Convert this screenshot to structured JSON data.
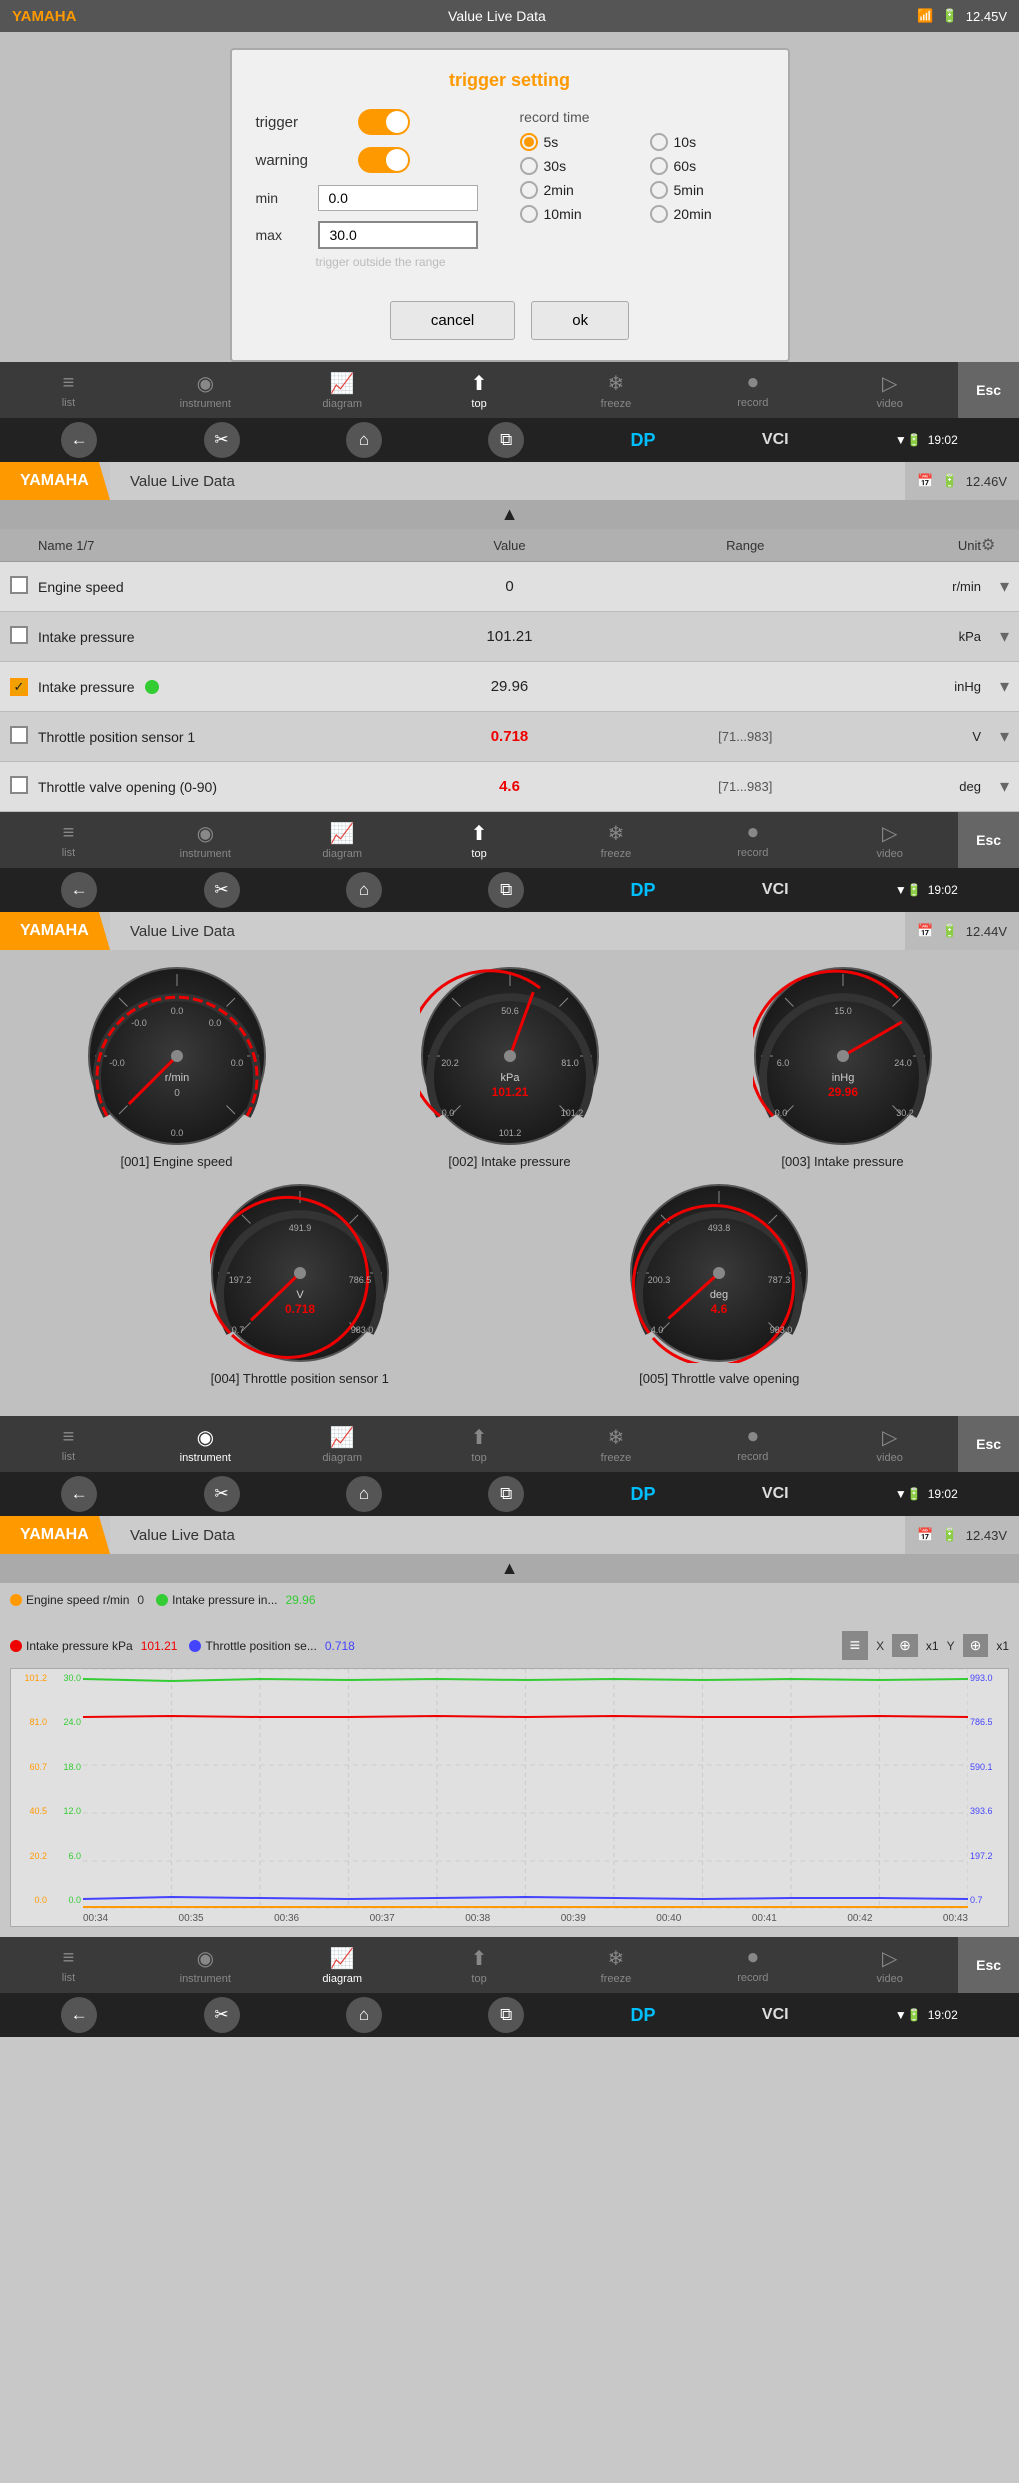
{
  "statusBar": {
    "brand": "YAMAHA",
    "title": "Value Live Data",
    "battery": "12.45V",
    "wifi": "▼",
    "battIcon": "🔋"
  },
  "modal": {
    "title": "trigger setting",
    "triggerLabel": "trigger",
    "warningLabel": "warning",
    "minLabel": "min",
    "maxLabel": "max",
    "minValue": "0.0",
    "maxValue": "30.0",
    "hint": "trigger outside the range",
    "recordTimeTitle": "record time",
    "recordOptions": [
      {
        "label": "5s",
        "selected": true
      },
      {
        "label": "10s",
        "selected": false
      },
      {
        "label": "30s",
        "selected": false
      },
      {
        "label": "60s",
        "selected": false
      },
      {
        "label": "2min",
        "selected": false
      },
      {
        "label": "5min",
        "selected": false
      },
      {
        "label": "10min",
        "selected": false
      },
      {
        "label": "20min",
        "selected": false
      }
    ],
    "cancelBtn": "cancel",
    "okBtn": "ok"
  },
  "navBar1": {
    "items": [
      {
        "id": "list",
        "label": "list",
        "icon": "≡"
      },
      {
        "id": "instrument",
        "label": "instrument",
        "icon": "◎"
      },
      {
        "id": "diagram",
        "label": "diagram",
        "icon": "⟋"
      },
      {
        "id": "top",
        "label": "top",
        "icon": "↑"
      },
      {
        "id": "freeze",
        "label": "freeze",
        "icon": "❄"
      },
      {
        "id": "record",
        "label": "record",
        "icon": "▶"
      },
      {
        "id": "video",
        "label": "video",
        "icon": "▷"
      }
    ],
    "esc": "Esc"
  },
  "toolbar1": {
    "back": "←",
    "scissors": "✂",
    "home": "⌂",
    "copy": "⧉",
    "dp": "DP",
    "vci": "VCI",
    "wifi": "▼",
    "battery": "🔋",
    "time": "19:02"
  },
  "section1": {
    "brand": "YAMAHA",
    "title": "Value Live Data",
    "calIcon": "📅",
    "battIcon": "🔋",
    "voltage": "12.46V"
  },
  "tableHeader": {
    "name": "Name  1/7",
    "value": "Value",
    "range": "Range",
    "unit": "Unit"
  },
  "tableRows": [
    {
      "checked": false,
      "name": "Engine speed",
      "value": "0",
      "valueRed": false,
      "range": "",
      "unit": "r/min",
      "hasDot": false
    },
    {
      "checked": false,
      "name": "Intake pressure",
      "value": "101.21",
      "valueRed": false,
      "range": "",
      "unit": "kPa",
      "hasDot": false
    },
    {
      "checked": true,
      "name": "Intake pressure",
      "value": "29.96",
      "valueRed": false,
      "range": "",
      "unit": "inHg",
      "hasDot": true
    },
    {
      "checked": false,
      "name": "Throttle position sensor 1",
      "value": "0.718",
      "valueRed": true,
      "range": "[71...983]",
      "unit": "V",
      "hasDot": false
    },
    {
      "checked": false,
      "name": "Throttle valve opening (0-90)",
      "value": "4.6",
      "valueRed": true,
      "range": "[71...983]",
      "unit": "deg",
      "hasDot": false
    }
  ],
  "section2": {
    "brand": "YAMAHA",
    "title": "Value Live Data",
    "voltage": "12.44V"
  },
  "gauges": [
    {
      "id": "g001",
      "label": "[001] Engine speed",
      "unit": "r/min",
      "value": 0,
      "min": 0,
      "max": 0.0,
      "topVal": "0.0",
      "leftVal": "-0.0",
      "rightVal": "0.0",
      "centerTop": "0",
      "centerLeft": "0",
      "centerRight": "0.0",
      "bottomVal": "0.0",
      "accentVal": ""
    },
    {
      "id": "g002",
      "label": "[002] Intake pressure",
      "unit": "kPa",
      "topVal": "50.6",
      "leftTop": "20.2",
      "centerVal": "101.21",
      "rightVal": "81.0",
      "bottomLeft": "0.0",
      "bottomRight": "101.2",
      "accentVal": "101.21"
    },
    {
      "id": "g003",
      "label": "[003] Intake pressure",
      "unit": "inHg",
      "topVal": "15.0",
      "leftTop": "6.0",
      "centerVal": "29.96",
      "rightVal": "24.0",
      "bottomLeft": "0.0",
      "bottomRight": "30.2",
      "accentVal": "29.96"
    }
  ],
  "gauges2": [
    {
      "id": "g004",
      "label": "[004] Throttle position sensor 1",
      "unit": "V",
      "topVal": "491.9",
      "leftTop": "197.2",
      "centerVal": "0.718",
      "rightVal": "786.5",
      "bottomLeft": "0.7",
      "bottomRight": "983.0"
    },
    {
      "id": "g005",
      "label": "[005] Throttle valve opening",
      "unit": "deg",
      "topVal": "493.8",
      "leftTop": "200.3",
      "centerVal": "4.6",
      "rightVal": "787.3",
      "bottomLeft": "4.0",
      "bottomRight": "983.0"
    }
  ],
  "section3": {
    "brand": "YAMAHA",
    "title": "Value Live Data",
    "voltage": "12.43V"
  },
  "diagramLegend": [
    {
      "color": "#f90",
      "label": "Engine speed r/min",
      "value": "0"
    },
    {
      "color": "#3c3",
      "label": "Intake pressure in...",
      "value": "29.96"
    },
    {
      "color": "#e00",
      "label": "Intake pressure kPa",
      "value": "101.21"
    },
    {
      "color": "#44f",
      "label": "Throttle position se...",
      "value": "0.718"
    }
  ],
  "diagramYLeft": [
    "101.2",
    "81.0",
    "60.7",
    "40.5",
    "20.2",
    "0.0"
  ],
  "diagramYLeft2": [
    "30.0",
    "24.0",
    "18.0",
    "12.0",
    "6.0",
    "0.0"
  ],
  "diagramYLeft3": [
    "993.0",
    "786.5",
    "590.1",
    "393.6",
    "197.2",
    "0.7"
  ],
  "diagramXLabels": [
    "00:34",
    "00:35",
    "00:36",
    "00:37",
    "00:38",
    "00:39",
    "00:40",
    "00:41",
    "00:42",
    "00:43"
  ],
  "navBar3": {
    "esc": "Esc"
  },
  "toolbar3": {
    "time": "19:02"
  }
}
